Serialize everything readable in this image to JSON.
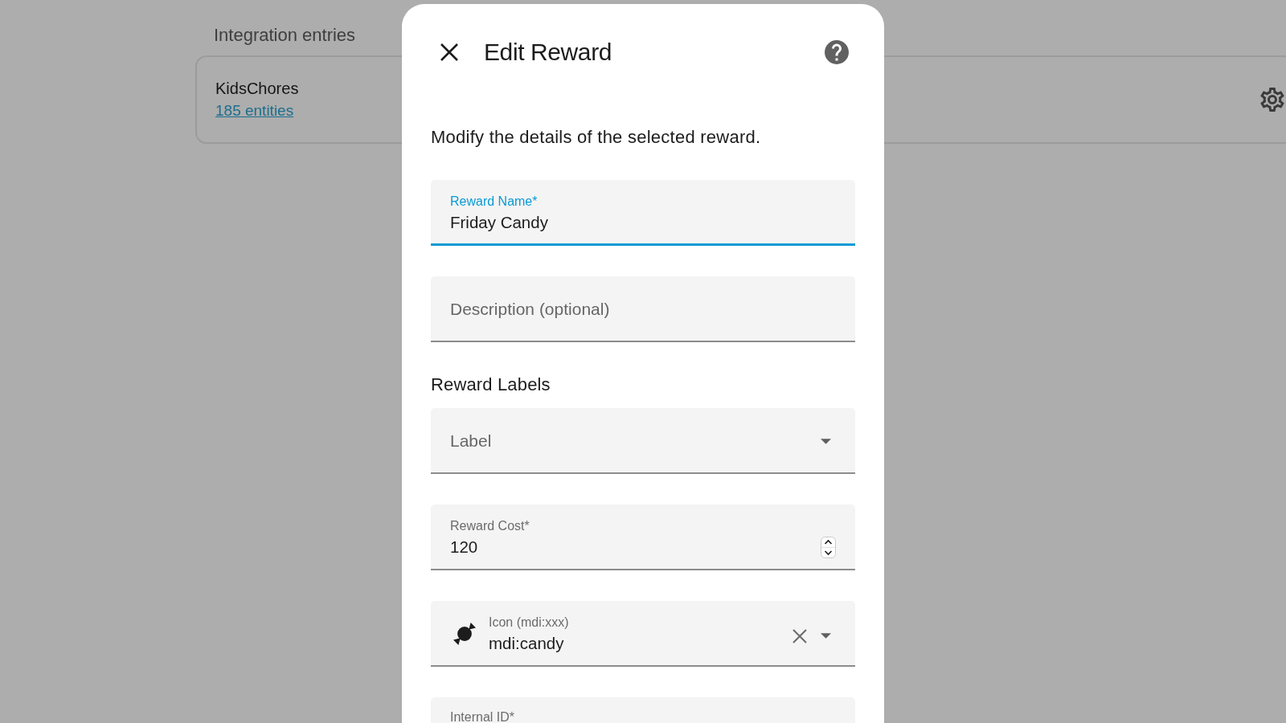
{
  "background": {
    "section_title": "Integration entries",
    "entry": {
      "name": "KidsChores",
      "link": "185 entities"
    }
  },
  "dialog": {
    "title": "Edit Reward",
    "description": "Modify the details of the selected reward.",
    "fields": [
      {
        "kind": "text",
        "label": "Reward Name*",
        "value": "Friday Candy",
        "focused": true
      },
      {
        "kind": "text",
        "placeholder": "Description (optional)",
        "focused": false
      },
      {
        "kind": "heading",
        "text": "Reward Labels"
      },
      {
        "kind": "select",
        "placeholder": "Label",
        "focused": false
      },
      {
        "kind": "number",
        "label": "Reward Cost*",
        "value": "120",
        "focused": false
      },
      {
        "kind": "icon_picker",
        "label": "Icon (mdi:xxx)",
        "value": "mdi:candy",
        "focused": false
      },
      {
        "kind": "text",
        "label": "Internal ID*",
        "focused": false
      }
    ]
  }
}
